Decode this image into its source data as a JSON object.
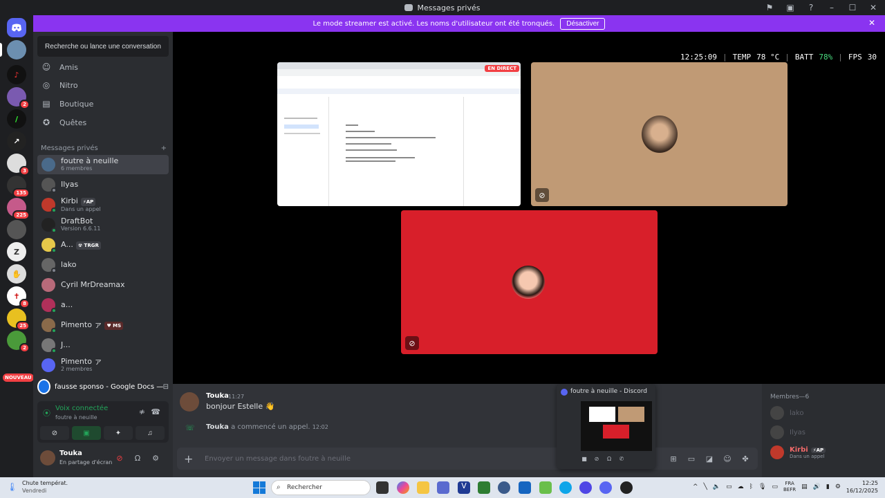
{
  "window": {
    "title": "Messages privés"
  },
  "banner": {
    "text": "Le mode streamer est activé. Les noms d'utilisateur ont été tronqués.",
    "button": "Désactiver"
  },
  "servers": [
    {
      "badge": ""
    },
    {
      "badge": ""
    },
    {
      "badge": ""
    },
    {
      "badge": "2"
    },
    {
      "badge": ""
    },
    {
      "badge": ""
    },
    {
      "badge": "3"
    },
    {
      "badge": "135"
    },
    {
      "badge": "225"
    },
    {
      "badge": ""
    },
    {
      "badge": ""
    },
    {
      "badge": ""
    },
    {
      "badge": ""
    },
    {
      "badge": "8"
    },
    {
      "badge": "25"
    },
    {
      "badge": "2"
    }
  ],
  "rail_new_label": "NOUVEAU",
  "sidebar": {
    "search": "Recherche ou lance une conversation",
    "nav": [
      {
        "label": "Amis",
        "icon": "friends-icon"
      },
      {
        "label": "Nitro",
        "icon": "nitro-icon"
      },
      {
        "label": "Boutique",
        "icon": "shop-icon"
      },
      {
        "label": "Quêtes",
        "icon": "quests-icon"
      }
    ],
    "dm_header": "Messages privés",
    "dm_add": "+",
    "dms": [
      {
        "name": "foutre à neuille",
        "sub": "6 membres",
        "tag": "",
        "color": "#4a6a8a"
      },
      {
        "name": "Ilyas",
        "sub": "",
        "tag": "",
        "color": "#555"
      },
      {
        "name": "Kirbi",
        "sub": "Dans un appel",
        "tag": "AP",
        "color": "#c0392b"
      },
      {
        "name": "DraftBot",
        "sub": "Version 6.6.11",
        "tag": "",
        "color": "#222"
      },
      {
        "name": "A...",
        "sub": "",
        "tag": "TRGR",
        "color": "#e6c84a"
      },
      {
        "name": "lako",
        "sub": "",
        "tag": "",
        "color": "#666"
      },
      {
        "name": "Cyril MrDreamax",
        "sub": "",
        "tag": "",
        "color": "#b86a7a"
      },
      {
        "name": "a...",
        "sub": "",
        "tag": "",
        "color": "#b0305a"
      },
      {
        "name": "Pimento ァ",
        "sub": "",
        "tag": "MS",
        "color": "#8a6a4a"
      },
      {
        "name": "J...",
        "sub": "",
        "tag": "",
        "color": "#777"
      },
      {
        "name": "Pimento ァ",
        "sub": "2 membres",
        "tag": "",
        "color": "#5865f2"
      }
    ]
  },
  "activity": {
    "text": "fausse sponso - Google Docs — Libr..."
  },
  "voice": {
    "title": "Voix connectée",
    "channel": "foutre à neuille"
  },
  "user": {
    "name": "Touka",
    "status": "En partage d'écran"
  },
  "hud": {
    "time": "12:25:09",
    "temp_label": "TEMP",
    "temp": "78 °C",
    "batt_label": "BATT",
    "batt": "78%",
    "fps_label": "FPS",
    "fps": "30"
  },
  "stage": {
    "live": "EN DIRECT"
  },
  "chat": {
    "author": "Touka",
    "time": "11:27",
    "text": "bonjour Estelle 👋",
    "call_author": "Touka",
    "call_text": "a commencé un appel.",
    "call_time": "12:02",
    "placeholder": "Envoyer un message dans foutre à neuille"
  },
  "thumbnail": {
    "title": "foutre à neuille - Discord"
  },
  "members": {
    "header": "Membres—6",
    "list": [
      {
        "name": "lako",
        "sub": "",
        "online": false
      },
      {
        "name": "Ilyas",
        "sub": "",
        "online": false
      },
      {
        "name": "Kirbi",
        "sub": "Dans un appel",
        "online": true
      }
    ]
  },
  "taskbar": {
    "weather_title": "Chute températ.",
    "weather_day": "Vendredi",
    "search": "Rechercher",
    "lang1": "FRA",
    "lang2": "BEFR",
    "clock_time": "12:25",
    "clock_date": "16/12/2025"
  }
}
